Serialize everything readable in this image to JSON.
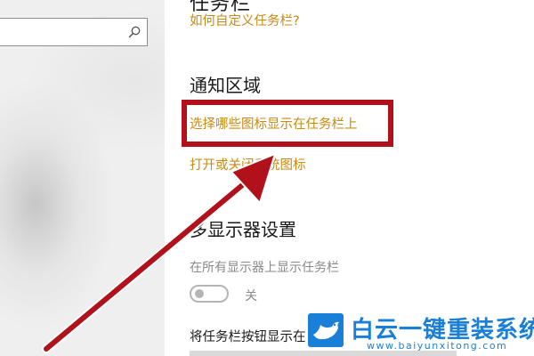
{
  "search": {
    "value": "",
    "placeholder": ""
  },
  "taskbar_settings": {
    "cut_heading": "任务栏",
    "link_customize": "如何自定义任务栏?",
    "notification_area": {
      "title": "通知区域",
      "link_select_icons": "选择哪些图标显示在任务栏上",
      "link_system_icons": "打开或关闭系统图标"
    },
    "multi_display": {
      "title": "多显示器设置",
      "show_on_all_label": "在所有显示器上显示任务栏",
      "toggle_state_text": "关",
      "toggle_on": false,
      "buttons_label": "将任务栏按钮显示在"
    }
  },
  "annotation": {
    "highlight_color": "#b0111b",
    "arrow_color": "#b0111b"
  },
  "watermark": {
    "brand": "白云一键重装系统",
    "url": "www.baiyunxitong.com",
    "color": "#1a7fd6"
  },
  "colors": {
    "link": "#c88a13",
    "text": "#1a1a1a",
    "muted": "#8a8a8a"
  }
}
